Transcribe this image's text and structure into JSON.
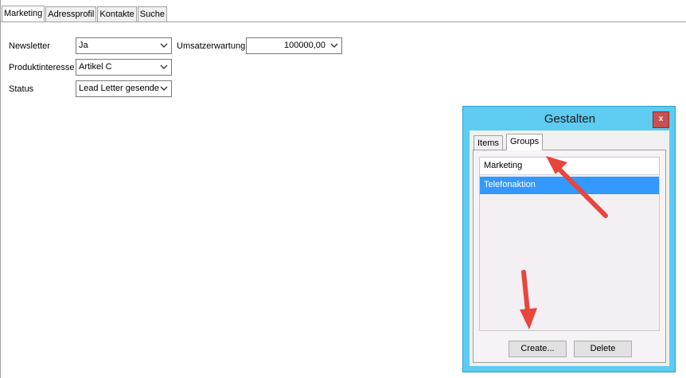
{
  "tabs": [
    {
      "label": "Marketing",
      "active": true
    },
    {
      "label": "Adressprofil",
      "active": false
    },
    {
      "label": "Kontakte",
      "active": false
    },
    {
      "label": "Suche",
      "active": false
    }
  ],
  "form": {
    "newsletter": {
      "label": "Newsletter",
      "value": "Ja"
    },
    "umsatzerwartung": {
      "label": "Umsatzerwartung",
      "value": "100000,00"
    },
    "produktinteresse": {
      "label": "Produktinteresse",
      "value": "Artikel C"
    },
    "status": {
      "label": "Status",
      "value": "Lead Letter gesende"
    }
  },
  "dialog": {
    "title": "Gestalten",
    "close_label": "x",
    "tabs": [
      {
        "label": "Items",
        "active": false
      },
      {
        "label": "Groups",
        "active": true
      }
    ],
    "list": {
      "header": "Marketing",
      "items": [
        {
          "label": "Telefonaktion",
          "selected": true
        }
      ]
    },
    "create_label": "Create...",
    "delete_label": "Delete"
  },
  "colors": {
    "dialog_frame": "#5ecbf0",
    "selection": "#3399ff",
    "close_button": "#c75050",
    "annotation_arrow": "#e8453c"
  },
  "icons": {
    "dropdown": "chevron-down-icon",
    "annotation": "arrow-icon"
  }
}
